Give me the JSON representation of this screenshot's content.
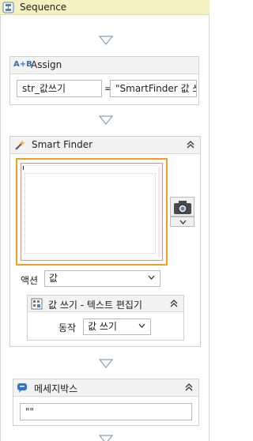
{
  "sequence": {
    "title": "Sequence"
  },
  "assign": {
    "title": "Assign",
    "icon_text": "A+B",
    "left_value": "str_값쓰기",
    "operator": "=",
    "right_value": "\"SmartFinder 값 쓰"
  },
  "smart_finder": {
    "title": "Smart Finder",
    "action_label": "액션",
    "action_value": "값",
    "sub": {
      "title": "값 쓰기 - 텍스트 편집기",
      "action_label": "동작",
      "action_value": "값 쓰기"
    }
  },
  "message_box": {
    "title": "메세지박스",
    "value": "\"\""
  },
  "colors": {
    "accent_orange": "#f0a020",
    "sequence_header": "#f5f0c2",
    "arrow": "#8aa0b8"
  }
}
